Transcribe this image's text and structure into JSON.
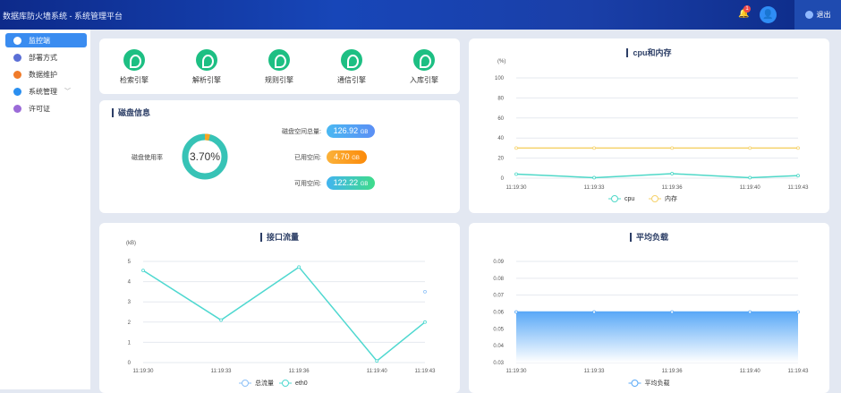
{
  "header": {
    "title": "数据库防火墙系统 - 系统管理平台",
    "notification_count": "1",
    "logout_label": "退出"
  },
  "sidebar": {
    "items": [
      {
        "label": "监控端",
        "color": "#ffffff"
      },
      {
        "label": "部署方式",
        "color": "#5b6fd6"
      },
      {
        "label": "数据维护",
        "color": "#f07b2a"
      },
      {
        "label": "系统管理",
        "color": "#2a8ff0"
      },
      {
        "label": "许可证",
        "color": "#9b6bd8"
      }
    ]
  },
  "engines": [
    {
      "label": "检索引擎"
    },
    {
      "label": "解析引擎"
    },
    {
      "label": "规则引擎"
    },
    {
      "label": "通信引擎"
    },
    {
      "label": "入库引擎"
    }
  ],
  "disk": {
    "title": "磁盘信息",
    "usage_label": "磁盘使用率",
    "usage_text": "3.70%",
    "usage_percent": 3.7,
    "total_label": "磁盘空间总量:",
    "total_value": "126.92",
    "used_label": "已用空间:",
    "used_value": "4.70",
    "free_label": "可用空间:",
    "free_value": "122.22",
    "unit": "GB"
  },
  "chart_data": [
    {
      "type": "line",
      "title": "cpu和内存",
      "ylabel": "(%)",
      "ylim": [
        0,
        100
      ],
      "yticks": [
        0,
        20,
        40,
        60,
        80,
        100
      ],
      "x": [
        "11:19:30",
        "11:19:33",
        "11:19:36",
        "11:19:40",
        "11:19:43"
      ],
      "x_seconds": [
        30,
        33.4,
        36.8,
        40.2,
        42.3
      ],
      "series": [
        {
          "name": "cpu",
          "color": "#4fd8c8",
          "values": [
            4,
            0.5,
            4.5,
            0.5,
            2.5
          ]
        },
        {
          "name": "内存",
          "color": "#f5d26a",
          "values": [
            30,
            30,
            30,
            30,
            30
          ]
        }
      ]
    },
    {
      "type": "line",
      "title": "接口流量",
      "ylabel": "(kB)",
      "ylim": [
        0,
        5
      ],
      "yticks": [
        0,
        1,
        2,
        3,
        4,
        5
      ],
      "x": [
        "11:19:30",
        "11:19:33",
        "11:19:36",
        "11:19:40",
        "11:19:43"
      ],
      "x_seconds": [
        30,
        33.4,
        36.8,
        40.2,
        42.3
      ],
      "series": [
        {
          "name": "总流量",
          "color": "#8cc0f7",
          "values": [
            null,
            null,
            null,
            null,
            3.5
          ]
        },
        {
          "name": "eth0",
          "color": "#4fd8d0",
          "values": [
            4.55,
            2.1,
            4.72,
            0.08,
            2.0
          ]
        }
      ]
    },
    {
      "type": "area",
      "title": "平均负载",
      "ylabel": "",
      "ylim": [
        0.03,
        0.09
      ],
      "yticks": [
        0.03,
        0.04,
        0.05,
        0.06,
        0.07,
        0.08,
        0.09
      ],
      "x": [
        "11:19:30",
        "11:19:33",
        "11:19:36",
        "11:19:40",
        "11:19:43"
      ],
      "x_seconds": [
        30,
        33.4,
        36.8,
        40.2,
        42.3
      ],
      "series": [
        {
          "name": "平均负载",
          "color": "#5aa9f7",
          "values": [
            0.06,
            0.06,
            0.06,
            0.06,
            0.06
          ]
        }
      ]
    }
  ]
}
